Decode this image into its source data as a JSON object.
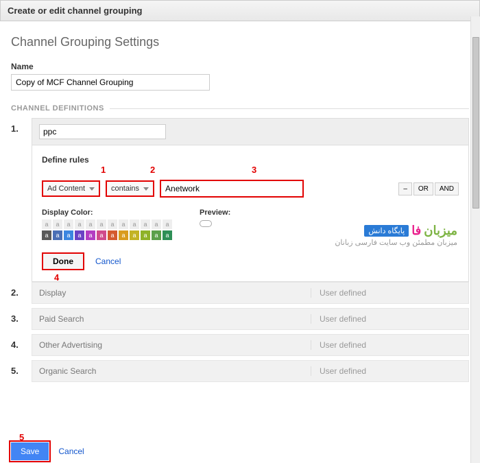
{
  "header": {
    "title": "Create or edit channel grouping"
  },
  "settings": {
    "title": "Channel Grouping Settings",
    "name_label": "Name",
    "name_value": "Copy of MCF Channel Grouping",
    "section": "CHANNEL DEFINITIONS"
  },
  "editor": {
    "channel_name": "ppc",
    "define_label": "Define rules",
    "dd1": "Ad Content",
    "dd2": "contains",
    "value_input": "Anetwork",
    "minus": "–",
    "or": "OR",
    "and": "AND",
    "display_color": "Display Color:",
    "preview": "Preview:",
    "done": "Done",
    "cancel": "Cancel",
    "swatch_glyph": "a",
    "dark_colors": [
      "#5a5a5a",
      "#4a6fb5",
      "#3b86e0",
      "#6a42c4",
      "#b43dc2",
      "#d04a8c",
      "#d45a2e",
      "#d99c1e",
      "#c3b324",
      "#8fb227",
      "#5aa04a",
      "#2e8f56"
    ]
  },
  "annotations": {
    "a1": "1",
    "a2": "2",
    "a3": "3",
    "a4": "4",
    "a5": "5"
  },
  "channels": [
    {
      "name": "Display",
      "type": "User defined"
    },
    {
      "name": "Paid Search",
      "type": "User defined"
    },
    {
      "name": "Other Advertising",
      "type": "User defined"
    },
    {
      "name": "Organic Search",
      "type": "User defined"
    }
  ],
  "watermark": {
    "badge": "پایگاه دانش",
    "green": "میزبان",
    "pink": "فا",
    "sub": "میزبان مطمئن وب سایت فارسی زبانان"
  },
  "footer": {
    "save": "Save",
    "cancel": "Cancel"
  }
}
